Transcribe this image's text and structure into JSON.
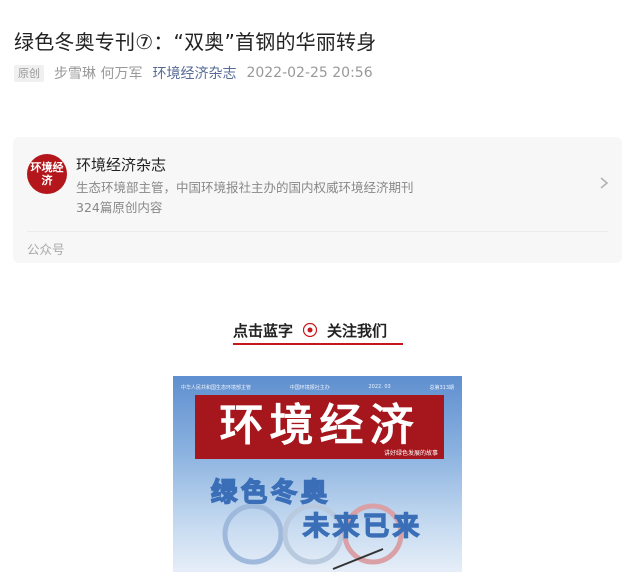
{
  "article": {
    "title": "绿色冬奥专刊⑦：“双奥”首钢的华丽转身",
    "tag": "原创",
    "authors": "步雪琳 何万军",
    "account_link": "环境经济杂志",
    "date": "2022-02-25 20:56"
  },
  "profile_card": {
    "logo_text": "环境经济",
    "name": "环境经济杂志",
    "description": "生态环境部主管，中国环境报社主办的国内权威环境经济期刊",
    "count": "324篇原创内容",
    "footer": "公众号"
  },
  "follow": {
    "left_text": "点击蓝字",
    "right_text": "关注我们"
  },
  "cover": {
    "top_left": "中华人民共和国生态环境部主管",
    "top_mid": "中国环境报社主办",
    "top_date": "2022. 03",
    "top_issue": "总第313期",
    "magazine_title": "环境经济",
    "subtitle": "讲好绿色发展的故事",
    "headline_1": "绿色冬奥",
    "headline_2": "未来已来"
  },
  "colors": {
    "accent_red": "#c8161d",
    "link_blue": "#576b95",
    "logo_red": "#b3161b"
  }
}
